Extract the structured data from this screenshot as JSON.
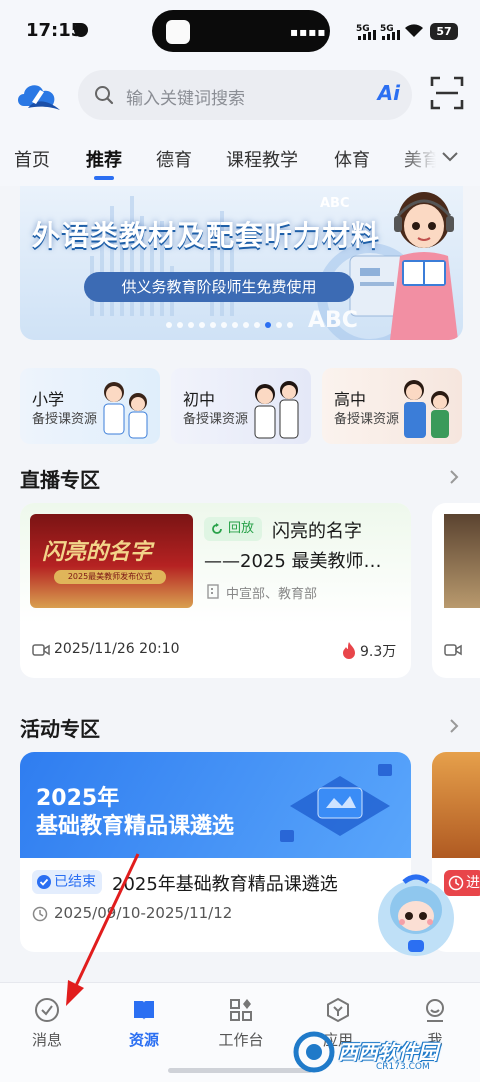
{
  "status": {
    "time": "17:15",
    "sig1": "5G",
    "sig2": "5G",
    "battery": "57"
  },
  "header": {
    "search_placeholder": "输入关键词搜索",
    "ai_label": "Ai"
  },
  "tabs": [
    {
      "label": "首页"
    },
    {
      "label": "推荐",
      "active": true
    },
    {
      "label": "德育"
    },
    {
      "label": "课程教学"
    },
    {
      "label": "体育"
    },
    {
      "label": "美育"
    }
  ],
  "banner": {
    "title": "外语类教材及配套听力材料",
    "pill": "供义务教育阶段师生免费使用",
    "abc_small": "ABC",
    "abc_large": "ABC",
    "page_count": 12,
    "active_index": 9
  },
  "categories": [
    {
      "title": "小学",
      "sub": "备授课资源"
    },
    {
      "title": "初中",
      "sub": "备授课资源"
    },
    {
      "title": "高中",
      "sub": "备授课资源"
    }
  ],
  "live": {
    "section_title": "直播专区",
    "thumb_title": "闪亮的名字",
    "thumb_sub": "2025最美教师发布仪式",
    "badge": "回放",
    "title_line1": "闪亮的名字",
    "title_line2": "——2025 最美教师…",
    "org": "中宣部、教育部",
    "time": "2025/11/26 20:10",
    "views": "9.3万"
  },
  "activity": {
    "section_title": "活动专区",
    "banner_line1": "2025年",
    "banner_line2": "基础教育精品课遴选",
    "badge": "已结束",
    "title": "2025年基础教育精品课遴选",
    "date_range": "2025/09/10-2025/11/12",
    "next_badge": "进"
  },
  "bottom_nav": [
    {
      "label": "消息",
      "icon": "check-circle-icon"
    },
    {
      "label": "资源",
      "icon": "book-icon",
      "active": true
    },
    {
      "label": "工作台",
      "icon": "grid-icon"
    },
    {
      "label": "应用",
      "icon": "hexagon-icon"
    },
    {
      "label": "我",
      "icon": "person-icon"
    }
  ],
  "watermark": {
    "text": "西西软件园",
    "sub": "CR173.COM"
  },
  "colors": {
    "accent": "#2b6ff2",
    "live_green": "#27a148",
    "fire": "#e8454a"
  }
}
